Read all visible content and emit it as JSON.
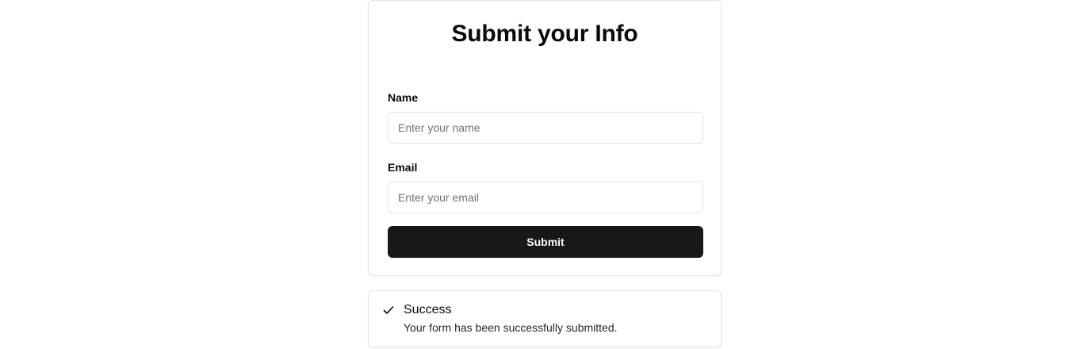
{
  "form": {
    "title": "Submit your Info",
    "name_label": "Name",
    "name_placeholder": "Enter your name",
    "name_value": "",
    "email_label": "Email",
    "email_placeholder": "Enter your email",
    "email_value": "",
    "submit_label": "Submit"
  },
  "toast": {
    "icon": "check-icon",
    "title": "Success",
    "description": "Your form has been successfully submitted."
  },
  "colors": {
    "primary_button": "#18181b",
    "border": "#e4e4e7",
    "placeholder": "#71717a"
  }
}
